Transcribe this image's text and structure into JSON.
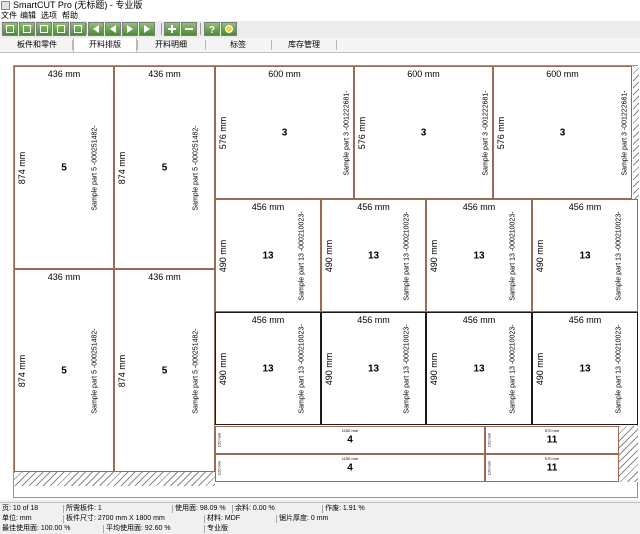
{
  "window": {
    "title": "SmartCUT Pro (无标题) - 专业版"
  },
  "menu": [
    "文件",
    "编辑",
    "选项",
    "帮助"
  ],
  "toolbar": {
    "icons": [
      "new-icon",
      "open-icon",
      "save-icon",
      "print-icon",
      "optimize-icon",
      "first-page-icon",
      "prev-page-icon",
      "next-page-icon",
      "last-page-icon",
      "zoom-in-icon",
      "zoom-out-icon",
      "help-icon",
      "settings-icon"
    ]
  },
  "tabs": [
    "板件和零件",
    "开料排版",
    "开料明细",
    "标签",
    "库存管理"
  ],
  "active_tab": 1,
  "parts": [
    {
      "w": "436 mm",
      "h": "874 mm",
      "n": "5",
      "name": "Sample part 5 -000251482-",
      "sel": false
    },
    {
      "w": "436 mm",
      "h": "874 mm",
      "n": "5",
      "name": "Sample part 5 -000251482-",
      "sel": false
    },
    {
      "w": "600 mm",
      "h": "576 mm",
      "n": "3",
      "name": "Sample part 3 -001222681-",
      "sel": false
    },
    {
      "w": "600 mm",
      "h": "576 mm",
      "n": "3",
      "name": "Sample part 3 -001222681-",
      "sel": false
    },
    {
      "w": "600 mm",
      "h": "576 mm",
      "n": "3",
      "name": "Sample part 3 -001222681-",
      "sel": false
    },
    {
      "w": "436 mm",
      "h": "874 mm",
      "n": "5",
      "name": "Sample part 5 -000251482-",
      "sel": false
    },
    {
      "w": "436 mm",
      "h": "874 mm",
      "n": "5",
      "name": "Sample part 5 -000251482-",
      "sel": false
    },
    {
      "w": "456 mm",
      "h": "490 mm",
      "n": "13",
      "name": "Sample part 13 -000210023-",
      "sel": false
    },
    {
      "w": "456 mm",
      "h": "490 mm",
      "n": "13",
      "name": "Sample part 13 -000210023-",
      "sel": false
    },
    {
      "w": "456 mm",
      "h": "490 mm",
      "n": "13",
      "name": "Sample part 13 -000210023-",
      "sel": false
    },
    {
      "w": "456 mm",
      "h": "490 mm",
      "n": "13",
      "name": "Sample part 13 -000210023-",
      "sel": false
    },
    {
      "w": "456 mm",
      "h": "490 mm",
      "n": "13",
      "name": "Sample part 13 -000210023-",
      "sel": true
    },
    {
      "w": "456 mm",
      "h": "490 mm",
      "n": "13",
      "name": "Sample part 13 -000210023-",
      "sel": true
    },
    {
      "w": "456 mm",
      "h": "490 mm",
      "n": "13",
      "name": "Sample part 13 -000210023-",
      "sel": true
    },
    {
      "w": "456 mm",
      "h": "490 mm",
      "n": "13",
      "name": "Sample part 13 -000210023-",
      "sel": true
    },
    {
      "w": "1150 mm",
      "h": "120 mm",
      "n": "4",
      "name": "",
      "sel": false
    },
    {
      "w": "1150 mm",
      "h": "120 mm",
      "n": "4",
      "name": "",
      "sel": false
    },
    {
      "w": "570 mm",
      "h": "120 mm",
      "n": "11",
      "name": "",
      "sel": false
    },
    {
      "w": "570 mm",
      "h": "120 mm",
      "n": "11",
      "name": "",
      "sel": false
    }
  ],
  "status": {
    "page": "页: 10 of 18",
    "parts_needed": "所需板件: 1",
    "used": "使用面: 98.09 %",
    "leftover": "余料: 0.00 %",
    "waste": "作废: 1.91 %",
    "unit": "单位: mm",
    "board_size": "板件尺寸: 2700 mm X 1800 mm",
    "material": "材料: MDF",
    "blade": "锯片厚度: 0 mm",
    "best_usage": "最佳使用面: 100.00 %",
    "avg_usage": "平均使用面: 92.60 %",
    "edition": "专业版"
  }
}
